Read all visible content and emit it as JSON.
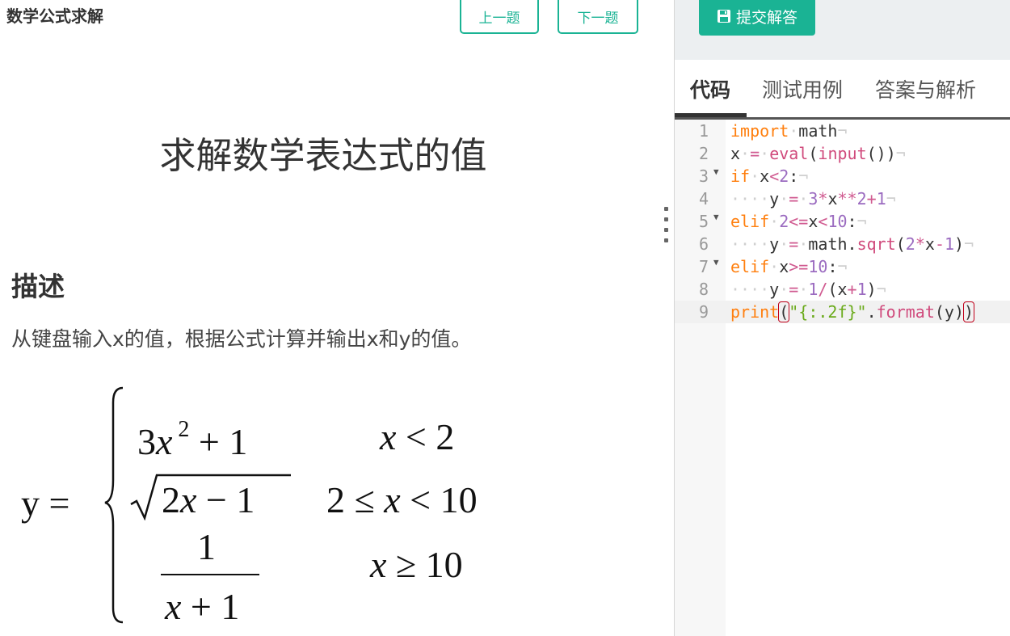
{
  "app": {
    "title": "数学公式求解"
  },
  "nav": {
    "prev_label": "上一题",
    "next_label": "下一题"
  },
  "problem": {
    "title": "求解数学表达式的值",
    "description_heading": "描述",
    "description_text": "从键盘输入x的值，根据公式计算并输出x和y的值。"
  },
  "formula": {
    "lhs": "y =",
    "cases": [
      {
        "expr": "3x² + 1",
        "condition": "x < 2"
      },
      {
        "expr": "√(2x − 1)",
        "condition": "2 ≤ x < 10"
      },
      {
        "expr": "1/(x + 1)",
        "condition": "x ≥ 10"
      }
    ]
  },
  "editor_panel": {
    "submit_label": "提交解答",
    "tabs": [
      {
        "label": "代码",
        "active": true
      },
      {
        "label": "测试用例",
        "active": false
      },
      {
        "label": "答案与解析",
        "active": false
      }
    ]
  },
  "code": {
    "active_line": 9,
    "lines": [
      "import math",
      "x = eval(input())",
      "if x<2:",
      "    y = 3*x**2+1",
      "elif 2<=x<10:",
      "    y = math.sqrt(2*x-1)",
      "elif x>=10:",
      "    y = 1/(x+1)",
      "print(\"{:.2f}\".format(y))"
    ],
    "line_numbers": [
      "1",
      "2",
      "3",
      "4",
      "5",
      "6",
      "7",
      "8",
      "9"
    ],
    "foldable_lines": [
      3,
      5,
      7
    ]
  },
  "colors": {
    "accent": "#1ab394",
    "keyword": "#ff7f0e",
    "builtin": "#d04a7c",
    "number": "#9b6bc0",
    "string": "#6aaa1a",
    "bracket_match": "#c0001a"
  },
  "icons": {
    "submit": "save-icon",
    "splitter": "drag-handle-icon",
    "fold": "fold-triangle-icon"
  }
}
